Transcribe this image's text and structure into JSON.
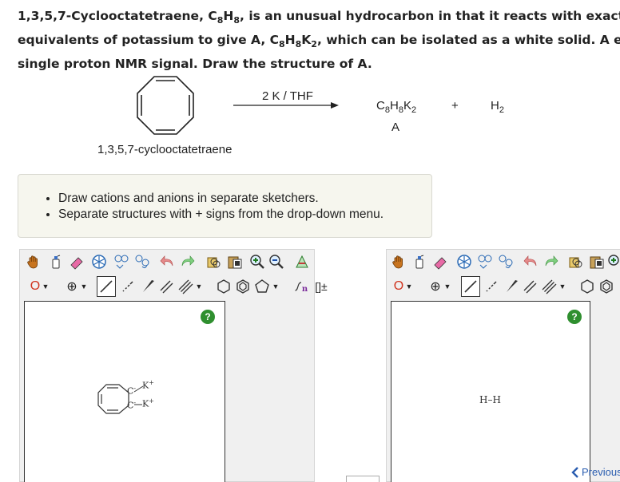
{
  "question": {
    "line1_a": "1,3,5,7-Cyclooctatetraene, C",
    "line1_sub1": "8",
    "line1_b": "H",
    "line1_sub2": "8",
    "line1_c": ", is an unusual hydrocarbon in that it reacts with exactly",
    "line2_a": "equivalents of potassium to give A, C",
    "line2_sub1": "8",
    "line2_b": "H",
    "line2_sub2": "8",
    "line2_c": "K",
    "line2_sub3": "2",
    "line2_d": ", which can be isolated as a white solid. A exhi",
    "line3": "single proton NMR signal. Draw the structure of A."
  },
  "scheme": {
    "reagent": "2 K / THF",
    "product_formula_a": "C",
    "product_formula_s1": "8",
    "product_formula_b": "H",
    "product_formula_s2": "8",
    "product_formula_c": "K",
    "product_formula_s3": "2",
    "product_label": "A",
    "plus": "+",
    "h2_main": "H",
    "h2_sub": "2",
    "reactant_name": "1,3,5,7-cyclooctatetraene"
  },
  "hints": [
    "Draw cations and anions in separate sketchers.",
    "Separate structures with + signs from the drop-down menu."
  ],
  "sketcher1": {
    "atom_selector": "O",
    "charge_selector": "⊕",
    "help": "?",
    "molecule": {
      "c1": "C",
      "c1_charge": "-",
      "k1": "K",
      "k1_charge": "+",
      "c2": "C",
      "c2_charge": "-",
      "k2": "K",
      "k2_charge": "+"
    }
  },
  "sketcher2": {
    "atom_selector": "O",
    "charge_selector": "⊕",
    "help": "?",
    "molecule_text": "H–H"
  },
  "navigation": {
    "previous": "Previous"
  }
}
